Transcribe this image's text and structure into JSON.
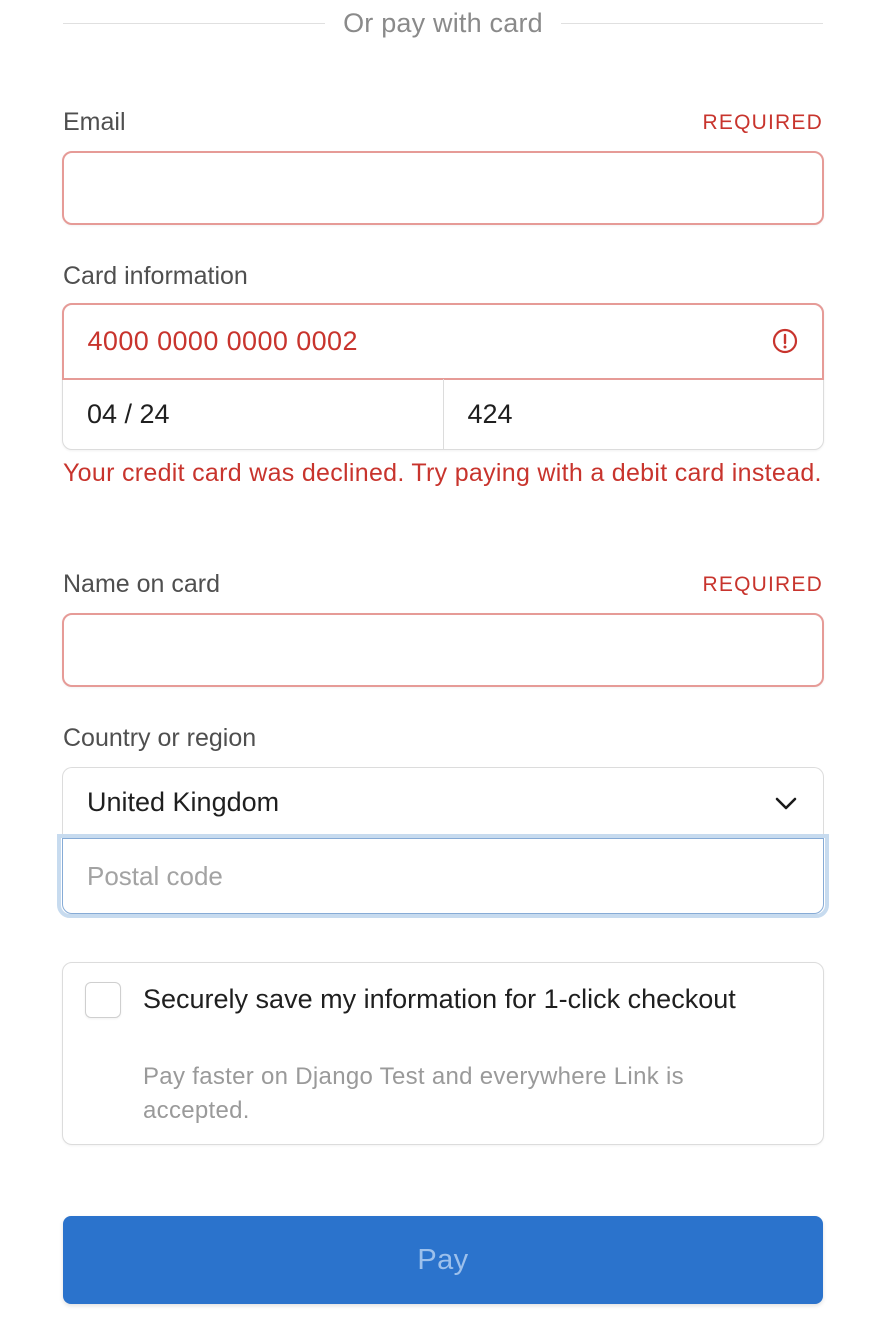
{
  "divider": {
    "text": "Or pay with card"
  },
  "email": {
    "label": "Email",
    "required": "REQUIRED",
    "value": ""
  },
  "card": {
    "label": "Card information",
    "number": "4000 0000 0000 0002",
    "expiry": "04 / 24",
    "cvc": "424",
    "error": "Your credit card was declined. Try paying with a debit card instead."
  },
  "name": {
    "label": "Name on card",
    "required": "REQUIRED",
    "value": ""
  },
  "country": {
    "label": "Country or region",
    "selected": "United Kingdom",
    "postal_placeholder": "Postal code"
  },
  "save": {
    "checked": false,
    "title": "Securely save my information for 1-click checkout",
    "subtitle": "Pay faster on Django Test and everywhere Link is accepted."
  },
  "pay": {
    "label": "Pay"
  },
  "colors": {
    "error": "#c8342d",
    "error_border": "#e69b97",
    "button": "#2b73cc",
    "button_text": "#9cc0ec",
    "focus_ring": "#c7dbef"
  }
}
